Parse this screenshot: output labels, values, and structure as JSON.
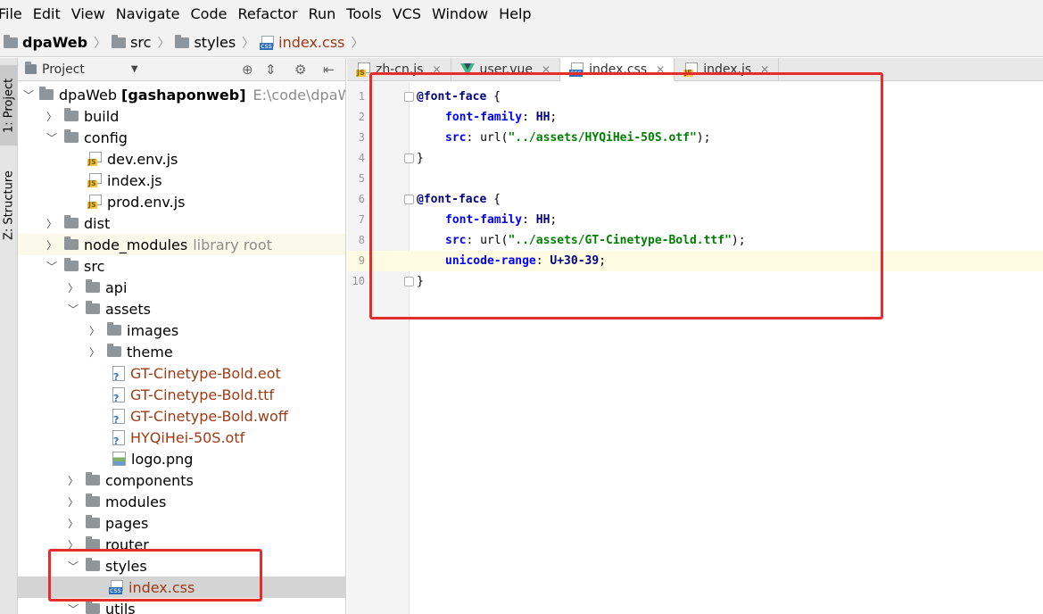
{
  "menubar": [
    "File",
    "Edit",
    "View",
    "Navigate",
    "Code",
    "Refactor",
    "Run",
    "Tools",
    "VCS",
    "Window",
    "Help"
  ],
  "breadcrumb": [
    "dpaWeb",
    "src",
    "styles",
    "index.css"
  ],
  "side_tabs": {
    "project": "1: Project",
    "structure": "Z: Structure"
  },
  "project_panel": {
    "title": "Project",
    "tree": {
      "root_name": "dpaWeb",
      "root_module": "[gashaponweb]",
      "root_path": "E:\\code\\dpaWeb",
      "build": "build",
      "config": "config",
      "dev_env": "dev.env.js",
      "index_js": "index.js",
      "prod_env": "prod.env.js",
      "dist": "dist",
      "node_modules": "node_modules",
      "library_root": "library root",
      "src": "src",
      "api": "api",
      "assets": "assets",
      "images": "images",
      "theme": "theme",
      "gt_eot": "GT-Cinetype-Bold.eot",
      "gt_ttf": "GT-Cinetype-Bold.ttf",
      "gt_woff": "GT-Cinetype-Bold.woff",
      "hyqihei": "HYQiHei-50S.otf",
      "logo": "logo.png",
      "components": "components",
      "modules": "modules",
      "pages": "pages",
      "router": "router",
      "styles": "styles",
      "index_css": "index.css",
      "utils": "utils"
    }
  },
  "editor_tabs": [
    {
      "label": "zh-cn.js"
    },
    {
      "label": "user.vue"
    },
    {
      "label": "index.css"
    },
    {
      "label": "index.js"
    }
  ],
  "code": {
    "l1_at": "@font-face",
    "l1_rest": " {",
    "l2_prop": "font-family",
    "l2_val": "HH",
    "l3_prop": "src",
    "l3_fn": "url(",
    "l3_str": "\"../assets/HYQiHei-50S.otf\"",
    "l4": "}",
    "l6_at": "@font-face",
    "l6_rest": " {",
    "l7_prop": "font-family",
    "l7_val": "HH",
    "l8_prop": "src",
    "l8_fn": "url(",
    "l8_str": "\"../assets/GT-Cinetype-Bold.ttf\"",
    "l9_prop": "unicode-range",
    "l9_val": "U+30-39",
    "l10": "}"
  },
  "line_numbers": [
    "1",
    "2",
    "3",
    "4",
    "5",
    "6",
    "7",
    "8",
    "9",
    "10"
  ],
  "colors": {
    "annotation_red": "#e52d2d",
    "string_green": "#008000",
    "property_blue": "#0000ff",
    "at_rule_navy": "#000080"
  }
}
